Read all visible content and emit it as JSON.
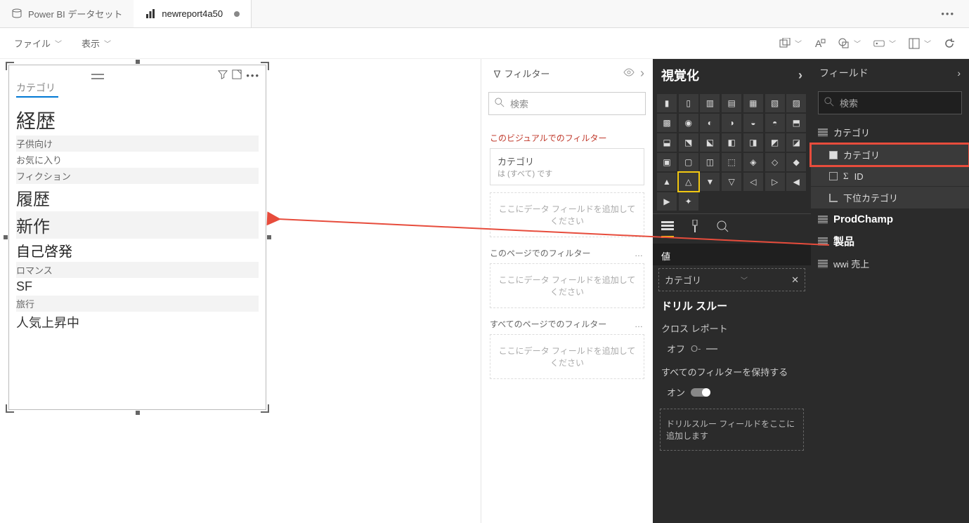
{
  "tabs": {
    "dataset": {
      "label": "Power BI データセット"
    },
    "report": {
      "label": "newreport4a50"
    }
  },
  "menu": {
    "file": "ファイル",
    "view": "表示"
  },
  "visual": {
    "header": "カテゴリ",
    "items": [
      {
        "text": "経歴",
        "cls": "big1"
      },
      {
        "text": "子供向け",
        "cls": "small alt"
      },
      {
        "text": "お気に入り",
        "cls": "small"
      },
      {
        "text": "フィクション",
        "cls": "small alt"
      },
      {
        "text": "履歴",
        "cls": "big2"
      },
      {
        "text": "新作",
        "cls": "big2 alt"
      },
      {
        "text": "自己啓発",
        "cls": "big3"
      },
      {
        "text": "ロマンス",
        "cls": "small alt"
      },
      {
        "text": "SF",
        "cls": "med"
      },
      {
        "text": "旅行",
        "cls": "small alt"
      },
      {
        "text": "人気上昇中",
        "cls": "med"
      }
    ]
  },
  "filters": {
    "title": "∇ フィルター",
    "search_placeholder": "検索",
    "visual_section": "このビジュアルでのフィルター",
    "card_title": "カテゴリ",
    "card_sub": "は (すべて) です",
    "visual_drop": "ここにデータ フィールドを追加してください",
    "page_section": "このページでのフィルター",
    "page_drop": "ここにデータ フィールドを追加してください",
    "all_section": "すべてのページでのフィルター",
    "all_drop": "ここにデータ フィールドを追加してください"
  },
  "viz": {
    "title": "視覚化",
    "value_label": "値",
    "field_chip": "カテゴリ",
    "drill_title": "ドリル スルー",
    "cross_report": "クロス レポート",
    "off_label": "オフ",
    "keep_filters": "すべてのフィルターを保持する",
    "on_label": "オン",
    "drill_drop": "ドリルスルー フィールドをここに追加します"
  },
  "fields": {
    "title": "フィールド",
    "search_placeholder": "検索",
    "tables": {
      "category": "カテゴリ",
      "category_col": "カテゴリ",
      "id_col": "ID",
      "subcat_col": "下位カテゴリ",
      "prodchamp": "ProdChamp",
      "product": "製品",
      "wwi": "wwi 売上"
    }
  },
  "toggle_off_extra": "O-"
}
